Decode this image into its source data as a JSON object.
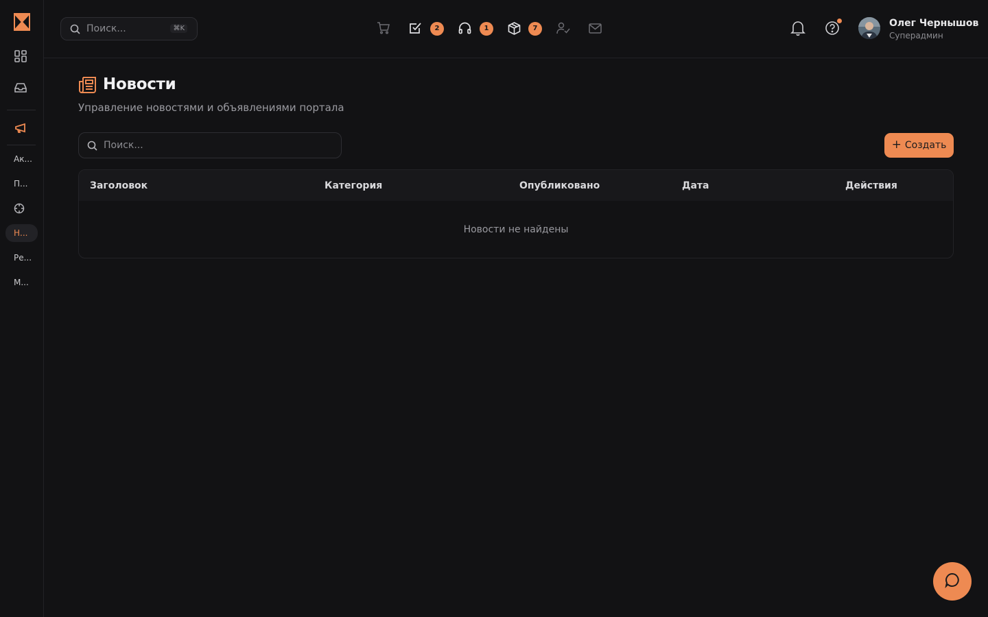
{
  "topbar": {
    "search_placeholder": "Поиск...",
    "search_shortcut": "⌘K",
    "badges": {
      "tasks": "2",
      "support": "1",
      "packages": "7"
    },
    "user": {
      "name": "Олег Чернышов",
      "role": "Суперадмин"
    }
  },
  "sidebar": {
    "items": [
      {
        "label": "Ак..."
      },
      {
        "label": "П..."
      },
      {
        "label": "Н..."
      },
      {
        "label": "Ре..."
      },
      {
        "label": "М..."
      }
    ]
  },
  "page": {
    "title": "Новости",
    "subtitle": "Управление новостями и объявлениями портала",
    "search_placeholder": "Поиск...",
    "create_label": "Создать",
    "table": {
      "columns": [
        "Заголовок",
        "Категория",
        "Опубликовано",
        "Дата",
        "Действия"
      ],
      "empty_text": "Новости не найдены"
    }
  },
  "colors": {
    "accent": "#ee8a52",
    "background": "#121214"
  }
}
